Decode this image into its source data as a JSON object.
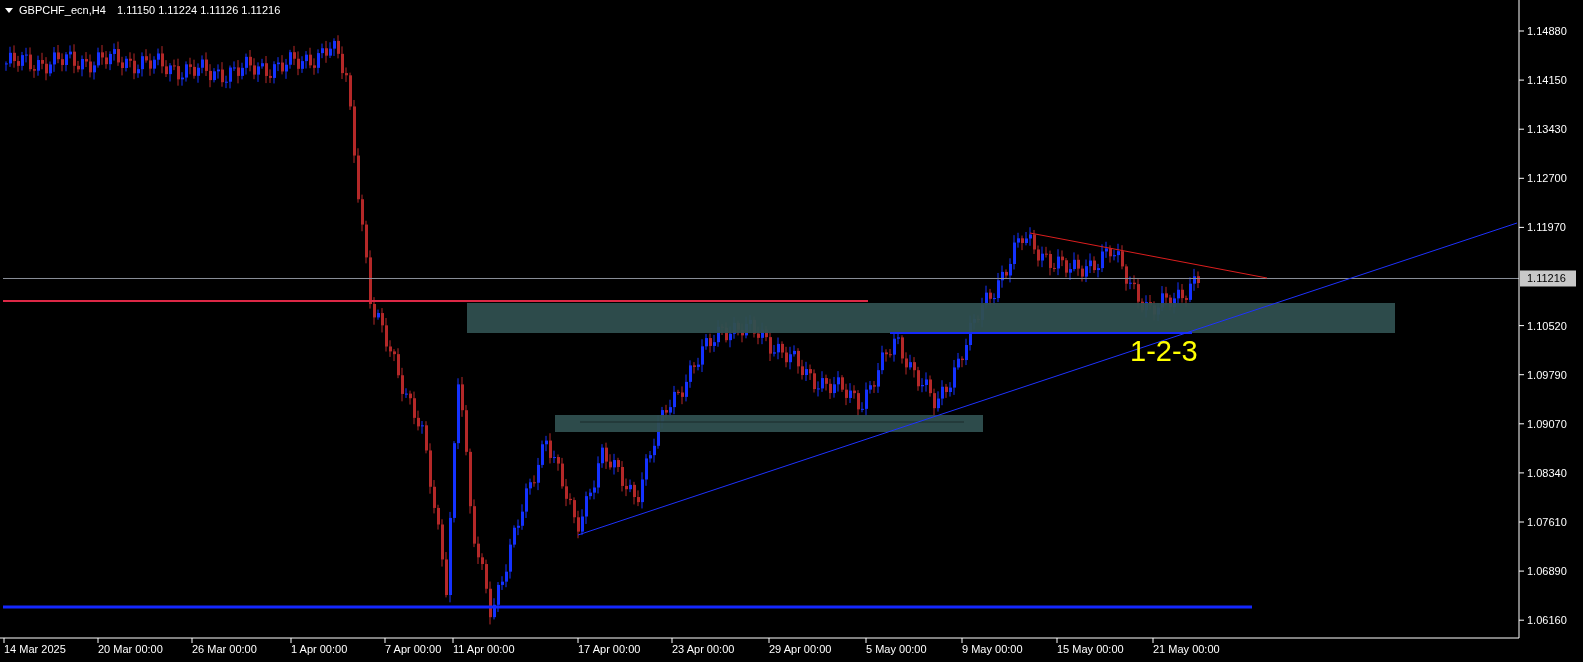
{
  "header": {
    "symbol": "GBPCHF_ecn,H4",
    "quote": "1.11150 1.11224 1.11126 1.11216"
  },
  "price_axis": {
    "ticks": [
      "1.14880",
      "1.14150",
      "1.13430",
      "1.12700",
      "1.11970",
      "1.10520",
      "1.09790",
      "1.09070",
      "1.08340",
      "1.07610",
      "1.06890",
      "1.06160"
    ],
    "current_price": "1.11216"
  },
  "time_axis": {
    "labels": [
      "14 Mar 2025",
      "20 Mar 00:00",
      "26 Mar 00:00",
      "1 Apr 00:00",
      "7 Apr 00:00",
      "11 Apr 00:00",
      "17 Apr 00:00",
      "23 Apr 00:00",
      "29 Apr 00:00",
      "5 May 00:00",
      "9 May 00:00",
      "15 May 00:00",
      "21 May 00:00"
    ]
  },
  "annotation": {
    "text": "1-2-3"
  }
}
